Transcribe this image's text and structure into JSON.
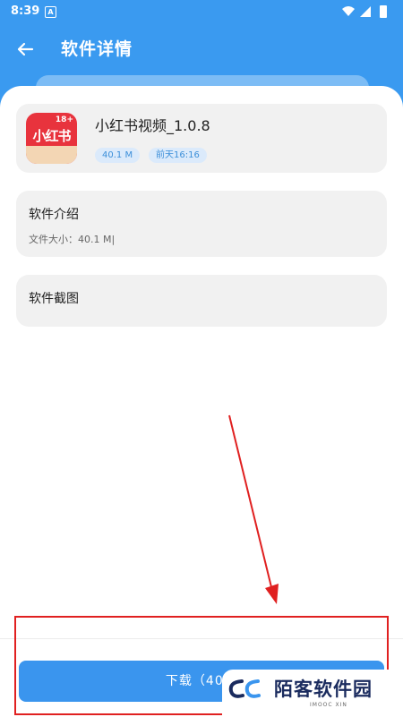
{
  "status": {
    "time": "8:39",
    "notif_letter": "A"
  },
  "header": {
    "title": "软件详情"
  },
  "app": {
    "name": "小红书视频_1.0.8",
    "size_chip": "40.1 M",
    "date_chip": "前天16:16",
    "icon_brand": "小红书",
    "icon_age": "18+"
  },
  "intro": {
    "title": "软件介绍",
    "file_size": "文件大小：40.1 M|"
  },
  "screenshots": {
    "title": "软件截图"
  },
  "download": {
    "label": "下载（40.1"
  },
  "watermark": {
    "text": "陌客软件园",
    "sub": "IMOOC XIN"
  },
  "colors": {
    "primary": "#3a9af0",
    "annotation": "#e02020"
  }
}
